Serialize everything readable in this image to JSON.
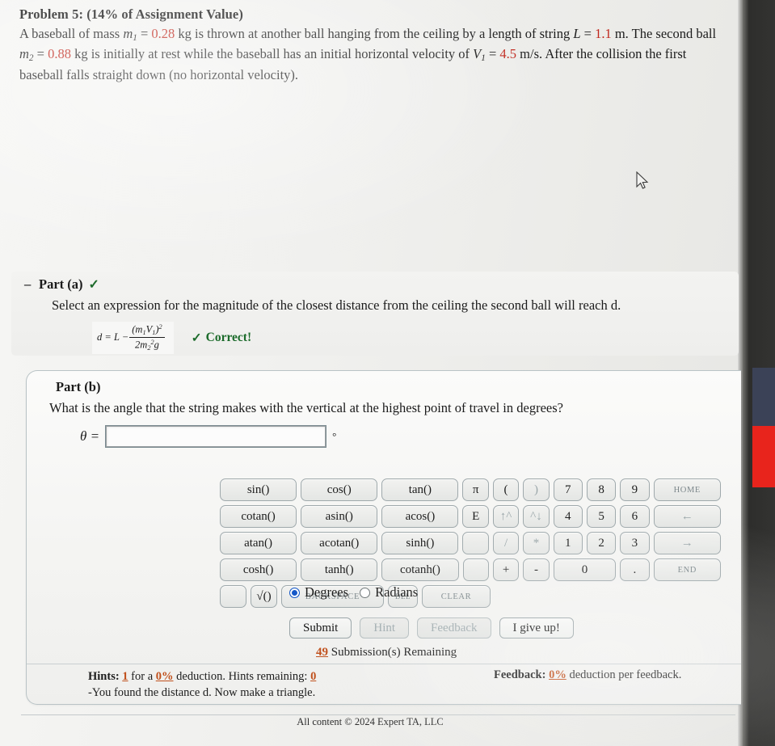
{
  "problem": {
    "title": "Problem 5: (14% of Assignment Value)",
    "body_lead": "A baseball of mass",
    "m1_symbol": "m",
    "m1_sub": "1",
    "m1_value": "0.28",
    "text_after_m1": "kg is thrown at another ball hanging from the ceiling by a length of string",
    "L_symbol": "L",
    "L_value": "1.1",
    "text_after_L": "m. The second ball",
    "m2_symbol": "m",
    "m2_sub": "2",
    "m2_value": "0.88",
    "text_after_m2": "kg is initially at rest while the baseball has an initial horizontal",
    "velocity_lead": "velocity of",
    "V1_symbol": "V",
    "V1_sub": "1",
    "V1_value": "4.5",
    "text_after_V1": "m/s. After the collision the first baseball falls straight down (no horizontal velocity)."
  },
  "part_a": {
    "collapse_icon": "minus-icon",
    "label": "Part (a)",
    "status_icon": "check-icon",
    "prompt": "Select an expression for the magnitude of the closest distance from the ceiling the second ball will reach d.",
    "formula": {
      "lhs": "d = L −",
      "numerator": "(m₁V₁)²",
      "denominator": "2m₂²g"
    },
    "correct_label": "Correct!"
  },
  "part_b": {
    "label": "Part (b)",
    "question": "What is the angle that the string makes with the vertical at the highest point of travel in degrees?",
    "answer_symbol": "θ =",
    "answer_value": "",
    "answer_placeholder": "",
    "unit": "°"
  },
  "keypad": {
    "rows": [
      [
        {
          "label": "sin()",
          "style": "fn"
        },
        {
          "label": "cos()",
          "style": "fn"
        },
        {
          "label": "tan()",
          "style": "fn"
        },
        {
          "label": "π",
          "style": "sm"
        },
        {
          "label": "(",
          "style": "sm"
        },
        {
          "label": ")",
          "style": "sm dim"
        },
        {
          "label": "7",
          "style": "num"
        },
        {
          "label": "8",
          "style": "num"
        },
        {
          "label": "9",
          "style": "num"
        },
        {
          "label": "HOME",
          "style": "wide tiny"
        }
      ],
      [
        {
          "label": "cotan()",
          "style": "fn"
        },
        {
          "label": "asin()",
          "style": "fn"
        },
        {
          "label": "acos()",
          "style": "fn"
        },
        {
          "label": "E",
          "style": "sm"
        },
        {
          "label": "↑^",
          "style": "sm dim"
        },
        {
          "label": "^↓",
          "style": "sm dim"
        },
        {
          "label": "4",
          "style": "num"
        },
        {
          "label": "5",
          "style": "num"
        },
        {
          "label": "6",
          "style": "num"
        },
        {
          "label": "←",
          "style": "wide dim"
        }
      ],
      [
        {
          "label": "atan()",
          "style": "fn"
        },
        {
          "label": "acotan()",
          "style": "fn"
        },
        {
          "label": "sinh()",
          "style": "fn"
        },
        {
          "label": "",
          "style": "blank"
        },
        {
          "label": "/",
          "style": "sm dim"
        },
        {
          "label": "*",
          "style": "sm dim"
        },
        {
          "label": "1",
          "style": "num"
        },
        {
          "label": "2",
          "style": "num"
        },
        {
          "label": "3",
          "style": "num"
        },
        {
          "label": "→",
          "style": "wide dim"
        }
      ],
      [
        {
          "label": "cosh()",
          "style": "fn"
        },
        {
          "label": "tanh()",
          "style": "fn"
        },
        {
          "label": "cotanh()",
          "style": "fn"
        },
        {
          "label": "",
          "style": "blank"
        },
        {
          "label": "+",
          "style": "sm"
        },
        {
          "label": "-",
          "style": "sm"
        },
        {
          "label": "0",
          "style": "zero"
        },
        {
          "label": ".",
          "style": "num"
        },
        {
          "label": "END",
          "style": "wide tiny"
        }
      ],
      [
        {
          "label": "",
          "style": "blank"
        },
        {
          "label": "√()",
          "style": "sm"
        },
        {
          "label": "BACKSPACE",
          "style": "backspace"
        },
        {
          "label": "DEL",
          "style": "del"
        },
        {
          "label": "CLEAR",
          "style": "wide tiny"
        }
      ]
    ]
  },
  "angle_mode": {
    "selected": "Degrees",
    "options": [
      {
        "label": "Degrees",
        "selected": true
      },
      {
        "label": "Radians",
        "selected": false
      }
    ]
  },
  "actions": [
    {
      "label": "Submit",
      "enabled": true
    },
    {
      "label": "Hint",
      "enabled": false
    },
    {
      "label": "Feedback",
      "enabled": false
    },
    {
      "label": "I give up!",
      "enabled": true
    }
  ],
  "submissions": {
    "count": "49",
    "text": "Submission(s) Remaining"
  },
  "hints": {
    "prefix": "Hints:",
    "count": "1",
    "mid1": "for a",
    "deduction": "0%",
    "mid2": "deduction. Hints remaining:",
    "remaining": "0",
    "hint_text": "-You found the distance d. Now make a triangle."
  },
  "feedback": {
    "prefix": "Feedback:",
    "deduction": "0%",
    "suffix": "deduction per feedback."
  },
  "footer": {
    "text": "All content © 2024 Expert TA, LLC"
  },
  "colors": {
    "value_red": "#c0271c",
    "correct_green": "#1c6b2b",
    "highlight_orange": "#c0501c",
    "radio_blue": "#1558c8"
  }
}
